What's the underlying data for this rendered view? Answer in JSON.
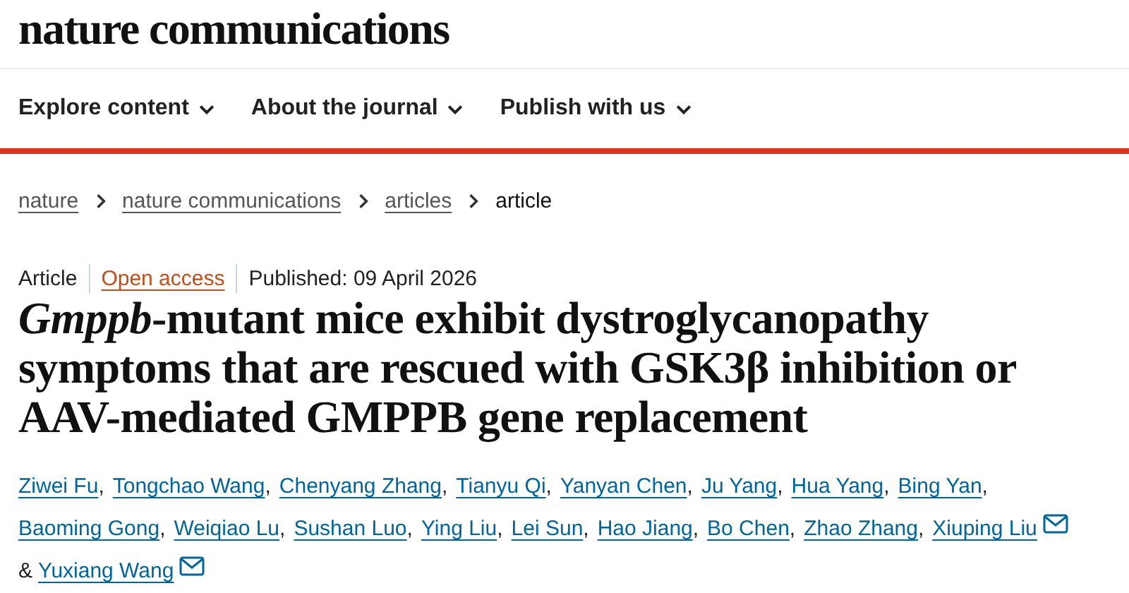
{
  "site": {
    "logo": "nature communications"
  },
  "nav": [
    {
      "label": "Explore content",
      "expanded": false
    },
    {
      "label": "About the journal",
      "expanded": false
    },
    {
      "label": "Publish with us",
      "expanded": false
    }
  ],
  "breadcrumb": [
    {
      "label": "nature",
      "link": true
    },
    {
      "label": "nature communications",
      "link": true
    },
    {
      "label": "articles",
      "link": true
    },
    {
      "label": "article",
      "link": false
    }
  ],
  "meta": {
    "type": "Article",
    "access": "Open access",
    "published": "Published: 09 April 2026"
  },
  "title": "*Gmppb*-mutant mice exhibit dystroglycanopathy symptoms that are rescued with GSK3β inhibition or AAV-mediated GMPPB gene replacement",
  "authors": [
    {
      "name": "Ziwei Fu",
      "suffix": ",",
      "email": false
    },
    {
      "name": "Tongchao Wang",
      "suffix": ",",
      "email": false
    },
    {
      "name": "Chenyang Zhang",
      "suffix": ",",
      "email": false
    },
    {
      "name": "Tianyu Qi",
      "suffix": ",",
      "email": false
    },
    {
      "name": "Yanyan Chen",
      "suffix": ",",
      "email": false
    },
    {
      "name": "Ju Yang",
      "suffix": ",",
      "email": false
    },
    {
      "name": "Hua Yang",
      "suffix": ",",
      "email": false
    },
    {
      "name": "Bing Yan",
      "suffix": ",",
      "email": false
    },
    {
      "name": "Baoming Gong",
      "suffix": ",",
      "email": false
    },
    {
      "name": "Weiqiao Lu",
      "suffix": ",",
      "email": false
    },
    {
      "name": "Sushan Luo",
      "suffix": ",",
      "email": false
    },
    {
      "name": "Ying Liu",
      "suffix": ",",
      "email": false
    },
    {
      "name": "Lei Sun",
      "suffix": ",",
      "email": false
    },
    {
      "name": "Hao Jiang",
      "suffix": ",",
      "email": false
    },
    {
      "name": "Bo Chen",
      "suffix": ",",
      "email": false
    },
    {
      "name": "Zhao Zhang",
      "suffix": ",",
      "email": false
    },
    {
      "name": "Xiuping Liu",
      "email": true
    },
    {
      "prefix": "&",
      "name": "Yuxiang Wang",
      "email": true
    }
  ]
}
